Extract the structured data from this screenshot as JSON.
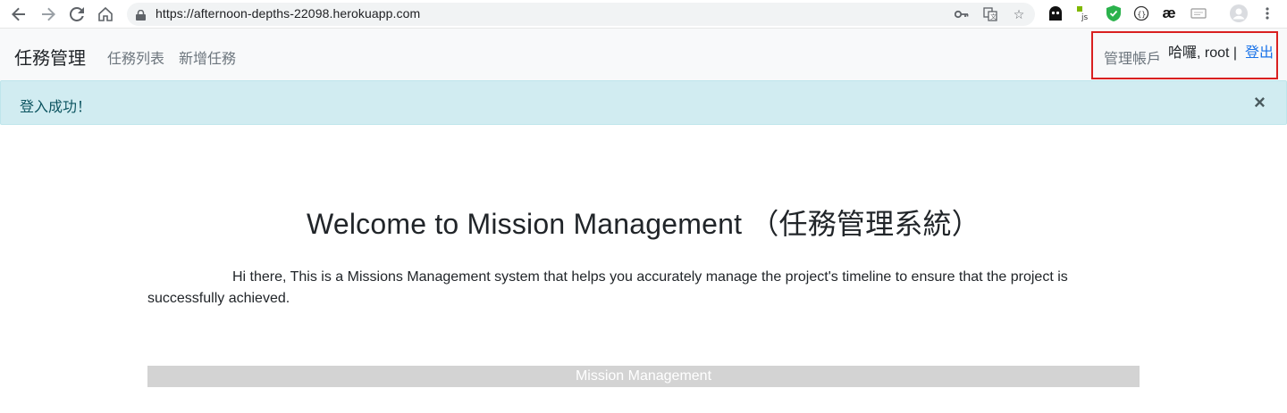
{
  "browser": {
    "url": "https://afternoon-depths-22098.herokuapp.com",
    "icons": [
      "back-arrow-icon",
      "forward-arrow-icon",
      "reload-icon",
      "home-icon",
      "lock-icon",
      "key-icon",
      "translate-icon",
      "star-icon"
    ],
    "extensions": [
      "ghost-extension-icon",
      "js-extension-icon",
      "shield-extension-icon",
      "code-extension-icon",
      "ae-extension-icon",
      "ticket-extension-icon",
      "profile-avatar-icon",
      "menu-kebab-icon"
    ],
    "ae_label": "æ",
    "js_label": "js"
  },
  "navbar": {
    "brand": "任務管理",
    "links": [
      "任務列表",
      "新增任務"
    ],
    "manage_account": "管理帳戶",
    "greeting": "哈囉, root |",
    "logout": "登出"
  },
  "alert": {
    "message": "登入成功！",
    "close": "×"
  },
  "main": {
    "title": "Welcome to Mission Management （任務管理系統）",
    "description": "Hi there, This is a Missions Management system that helps you accurately manage the project's timeline to ensure that the project is successfully achieved.",
    "footer": "Mission Management"
  },
  "colors": {
    "alert_bg": "#d1ecf1",
    "alert_text": "#0c5460",
    "link_blue": "#1a73e8",
    "highlight_border": "#d92020",
    "footer_bar": "#d3d3d3"
  }
}
